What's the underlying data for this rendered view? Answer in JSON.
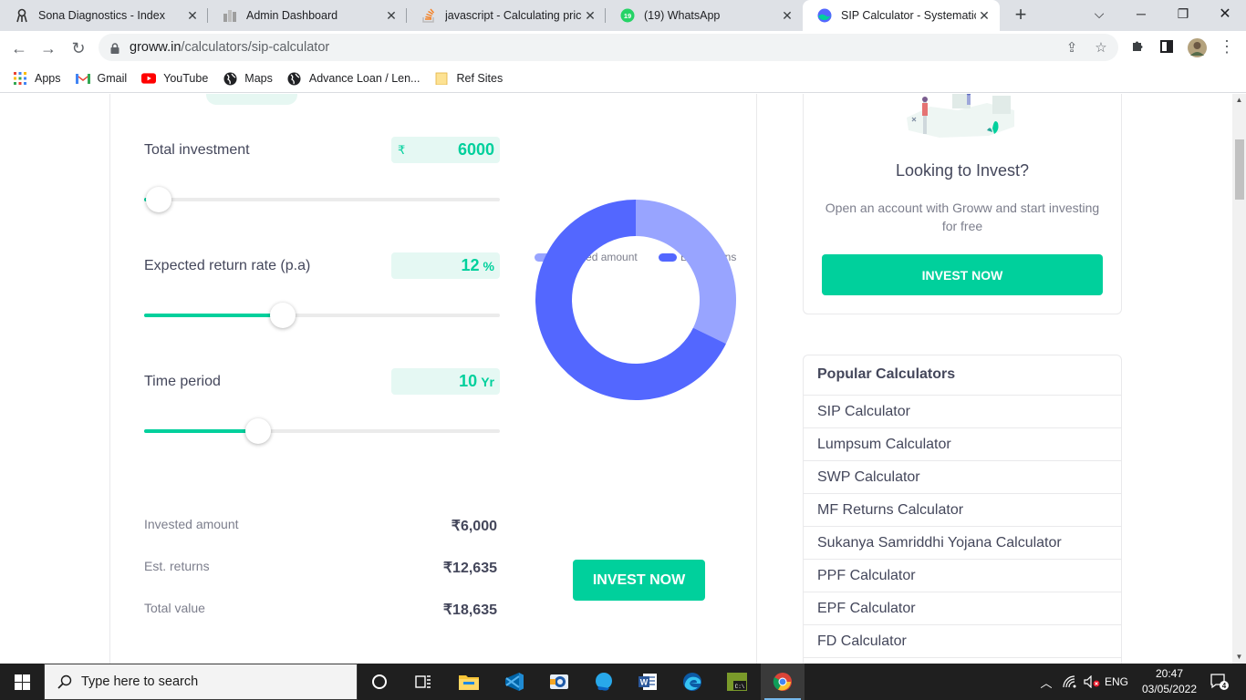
{
  "browser": {
    "tabs": [
      {
        "title": "Sona Diagnostics - Index",
        "icon": "sona-icon"
      },
      {
        "title": "Admin Dashboard",
        "icon": "dashboard-icon"
      },
      {
        "title": "javascript - Calculating price",
        "icon": "stackoverflow-icon"
      },
      {
        "title": "(19) WhatsApp",
        "icon": "whatsapp-icon",
        "badge": "19"
      },
      {
        "title": "SIP Calculator - Systematic In",
        "icon": "groww-icon",
        "active": true
      }
    ],
    "url_host": "groww.in",
    "url_path": "/calculators/sip-calculator",
    "bookmarks": [
      {
        "label": "Apps",
        "icon": "apps-grid-icon"
      },
      {
        "label": "Gmail",
        "icon": "gmail-icon"
      },
      {
        "label": "YouTube",
        "icon": "youtube-icon"
      },
      {
        "label": "Maps",
        "icon": "globe-icon"
      },
      {
        "label": "Advance Loan / Len...",
        "icon": "globe-icon"
      },
      {
        "label": "Ref Sites",
        "icon": "folder-icon"
      }
    ]
  },
  "calculator": {
    "fields": {
      "investment": {
        "label": "Total investment",
        "currency": "₹",
        "value": "6000",
        "slider_fraction": 0.04
      },
      "rate": {
        "label": "Expected return rate (p.a)",
        "value": "12",
        "unit": "%",
        "slider_fraction": 0.39
      },
      "period": {
        "label": "Time period",
        "value": "10",
        "unit": "Yr",
        "slider_fraction": 0.32
      }
    },
    "legend": {
      "invested": "Invested amount",
      "returns": "Est. returns"
    },
    "colors": {
      "invested": "#98a4ff",
      "returns": "#5367ff",
      "accent": "#00d09c"
    },
    "summary": {
      "invested_label": "Invested amount",
      "invested_value": "₹6,000",
      "returns_label": "Est. returns",
      "returns_value": "₹12,635",
      "total_label": "Total value",
      "total_value": "₹18,635"
    },
    "invest_button": "INVEST NOW"
  },
  "chart_data": {
    "type": "pie",
    "categories": [
      "Invested amount",
      "Est. returns"
    ],
    "values": [
      6000,
      12635
    ]
  },
  "promo": {
    "title": "Looking to Invest?",
    "subtitle": "Open an account with Groww and start investing for free",
    "button": "INVEST NOW"
  },
  "popular": {
    "heading": "Popular Calculators",
    "items": [
      "SIP Calculator",
      "Lumpsum Calculator",
      "SWP Calculator",
      "MF Returns Calculator",
      "Sukanya Samriddhi Yojana Calculator",
      "PPF Calculator",
      "EPF Calculator",
      "FD Calculator"
    ]
  },
  "taskbar": {
    "search_placeholder": "Type here to search",
    "language": "ENG",
    "time": "20:47",
    "date": "03/05/2022",
    "notifications": "4"
  }
}
